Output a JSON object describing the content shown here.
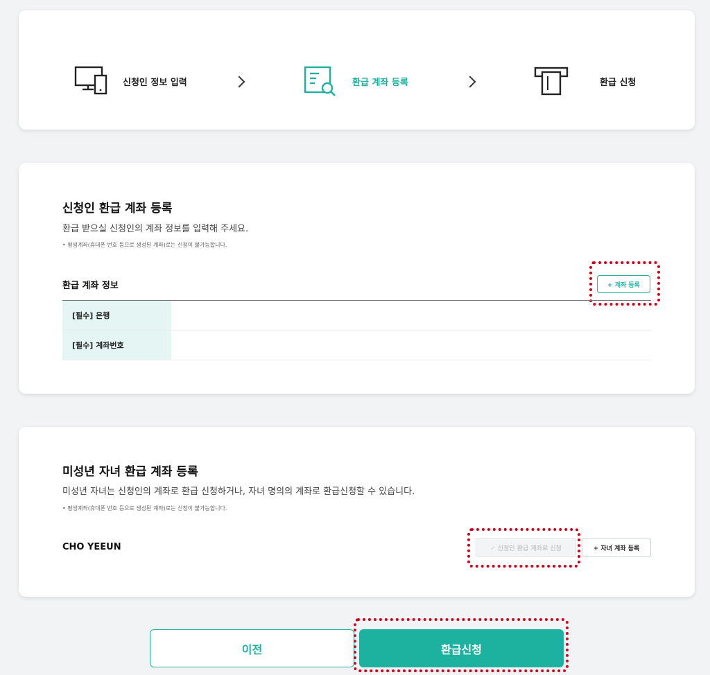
{
  "stepper": {
    "steps": [
      {
        "label": "신청인 정보 입력",
        "icon": "devices-icon",
        "active": false
      },
      {
        "label": "환급 계좌 등록",
        "icon": "document-search-icon",
        "active": true
      },
      {
        "label": "환급 신청",
        "icon": "terminal-icon",
        "active": false
      }
    ],
    "separator_icon": "chevron-right-icon"
  },
  "applicant_section": {
    "title": "신청인 환급 계좌 등록",
    "description": "환급 받으실 신청인의 계좌 정보를 입력해 주세요.",
    "note": "• 평생계좌(휴대폰 번호 등으로 생성된 계좌)로는 신청이 불가능합니다.",
    "subtitle": "환급 계좌 정보",
    "register_button": "+ 계좌 등록",
    "table": {
      "rows": [
        {
          "label": "[필수] 은행",
          "value": ""
        },
        {
          "label": "[필수] 계좌번호",
          "value": ""
        }
      ]
    }
  },
  "minor_section": {
    "title": "미성년 자녀 환급 계좌 등록",
    "description": "미성년 자녀는 신청인의 계좌로 환급 신청하거나, 자녀 명의의 계좌로 환급신청할 수 있습니다.",
    "note": "• 평생계좌(휴대폰 번호 등으로 생성된 계좌)로는 신청이 불가능합니다.",
    "child_name": "CHO YEEUN",
    "use_applicant_account_button": "✓ 신청인 환급 계좌로 신청",
    "register_child_account_button": "+ 자녀 계좌 등록"
  },
  "footer": {
    "prev_label": "이전",
    "submit_label": "환급신청"
  },
  "colors": {
    "accent": "#1db2a0",
    "highlight": "#d0021b",
    "table_header_bg": "#e4f5f3"
  }
}
